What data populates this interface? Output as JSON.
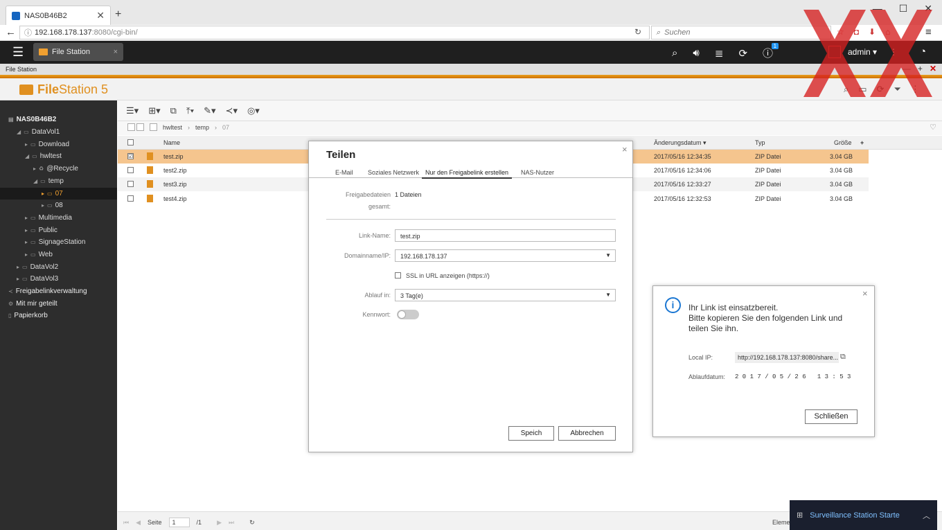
{
  "browser": {
    "tab_title": "NAS0B46B2",
    "tab_close": "✕",
    "new_tab": "+",
    "window_controls": [
      "—",
      "☐",
      "✕"
    ],
    "url_host": "192.168.178.137",
    "url_rest": ":8080/cgi-bin/",
    "search_placeholder": "Suchen"
  },
  "qts": {
    "app_tab": "File Station",
    "user": "admin ▾",
    "info_badge": "1"
  },
  "app": {
    "titlebar": "File Station",
    "logo_bold": "File",
    "logo_rest": "Station 5"
  },
  "sidebar": {
    "items": [
      {
        "label": "NAS0B46B2"
      },
      {
        "label": "DataVol1"
      },
      {
        "label": "Download"
      },
      {
        "label": "hwltest"
      },
      {
        "label": "@Recycle"
      },
      {
        "label": "temp"
      },
      {
        "label": "07"
      },
      {
        "label": "08"
      },
      {
        "label": "Multimedia"
      },
      {
        "label": "Public"
      },
      {
        "label": "SignageStation"
      },
      {
        "label": "Web"
      },
      {
        "label": "DataVol2"
      },
      {
        "label": "DataVol3"
      },
      {
        "label": "Freigabelinkverwaltung"
      },
      {
        "label": "Mit mir geteilt"
      },
      {
        "label": "Papierkorb"
      }
    ]
  },
  "breadcrumb": [
    "hwltest",
    "temp",
    "07"
  ],
  "table": {
    "headers": [
      "Name",
      "Änderungsdatum ▾",
      "Typ",
      "Größe",
      "+"
    ],
    "rows": [
      {
        "name": "test.zip",
        "date": "2017/05/16 12:34:35",
        "type": "ZIP Datei",
        "size": "3.04 GB",
        "checked": "☑"
      },
      {
        "name": "test2.zip",
        "date": "2017/05/16 12:34:06",
        "type": "ZIP Datei",
        "size": "3.04 GB",
        "checked": ""
      },
      {
        "name": "test3.zip",
        "date": "2017/05/16 12:33:27",
        "type": "ZIP Datei",
        "size": "3.04 GB",
        "checked": ""
      },
      {
        "name": "test4.zip",
        "date": "2017/05/16 12:32:53",
        "type": "ZIP Datei",
        "size": "3.04 GB",
        "checked": ""
      }
    ]
  },
  "share_dialog": {
    "title": "Teilen",
    "close": "×",
    "tabs": [
      "E-Mail",
      "Soziales Netzwerk",
      "Nur den Freigabelink erstellen",
      "NAS-Nutzer"
    ],
    "files_label_1": "Freigabedateien",
    "files_label_2": "gesamt:",
    "files_value": "1 Dateien",
    "link_name_label": "Link-Name:",
    "link_name_value": "test.zip",
    "domain_label": "Domainname/IP:",
    "domain_value": "192.168.178.137",
    "ssl_label": "SSL in URL anzeigen (https://)",
    "expire_label": "Ablauf in:",
    "expire_value": "3 Tag(e)",
    "password_label": "Kennwort:",
    "save_button": "Speich",
    "cancel_button": "Abbrechen"
  },
  "link_popup": {
    "line1": "Ihr Link ist einsatzbereit.",
    "line2": "Bitte kopieren Sie den folgenden Link und",
    "line3": "teilen Sie ihn.",
    "local_ip_label": "Local IP:",
    "local_ip_value": "http://192.168.178.137:8080/share...",
    "expiry_label": "Ablaufdatum:",
    "expiry_value": "2 0 1 7 / 0 5 / 2 6   1 3 : 5 3",
    "close_button": "Schließen",
    "close_x": "×"
  },
  "bottom": {
    "page_label": "Seite",
    "page_value": "1",
    "page_total": "/1",
    "elements_label": "Elemen"
  },
  "surveillance": {
    "label": "Surveillance Station Starte"
  },
  "colors": {
    "accent": "#e09020",
    "selected_row": "#f5c58e",
    "sidebar_bg": "#2d2d2d",
    "x_overlay": "#d62020"
  }
}
